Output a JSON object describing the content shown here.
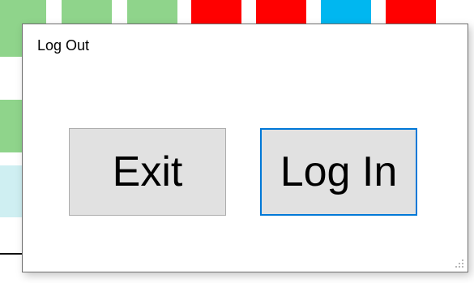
{
  "dialog": {
    "title": "Log Out",
    "buttons": {
      "exit_label": "Exit",
      "login_label": "Log In"
    },
    "accent_focus_border": "#0078d7"
  },
  "background": {
    "tiles": [
      {
        "color": "#8fd48b"
      },
      {
        "color": "#8fd48b"
      },
      {
        "color": "#8fd48b"
      },
      {
        "color": "#ff0000"
      },
      {
        "color": "#ff0000"
      },
      {
        "color": "#00b7f0"
      },
      {
        "color": "#ff0000"
      }
    ],
    "left_rows": [
      {
        "color": "#8fd48b"
      },
      {
        "color": "#8fd48b"
      },
      {
        "color": "#cfeff2"
      }
    ]
  }
}
